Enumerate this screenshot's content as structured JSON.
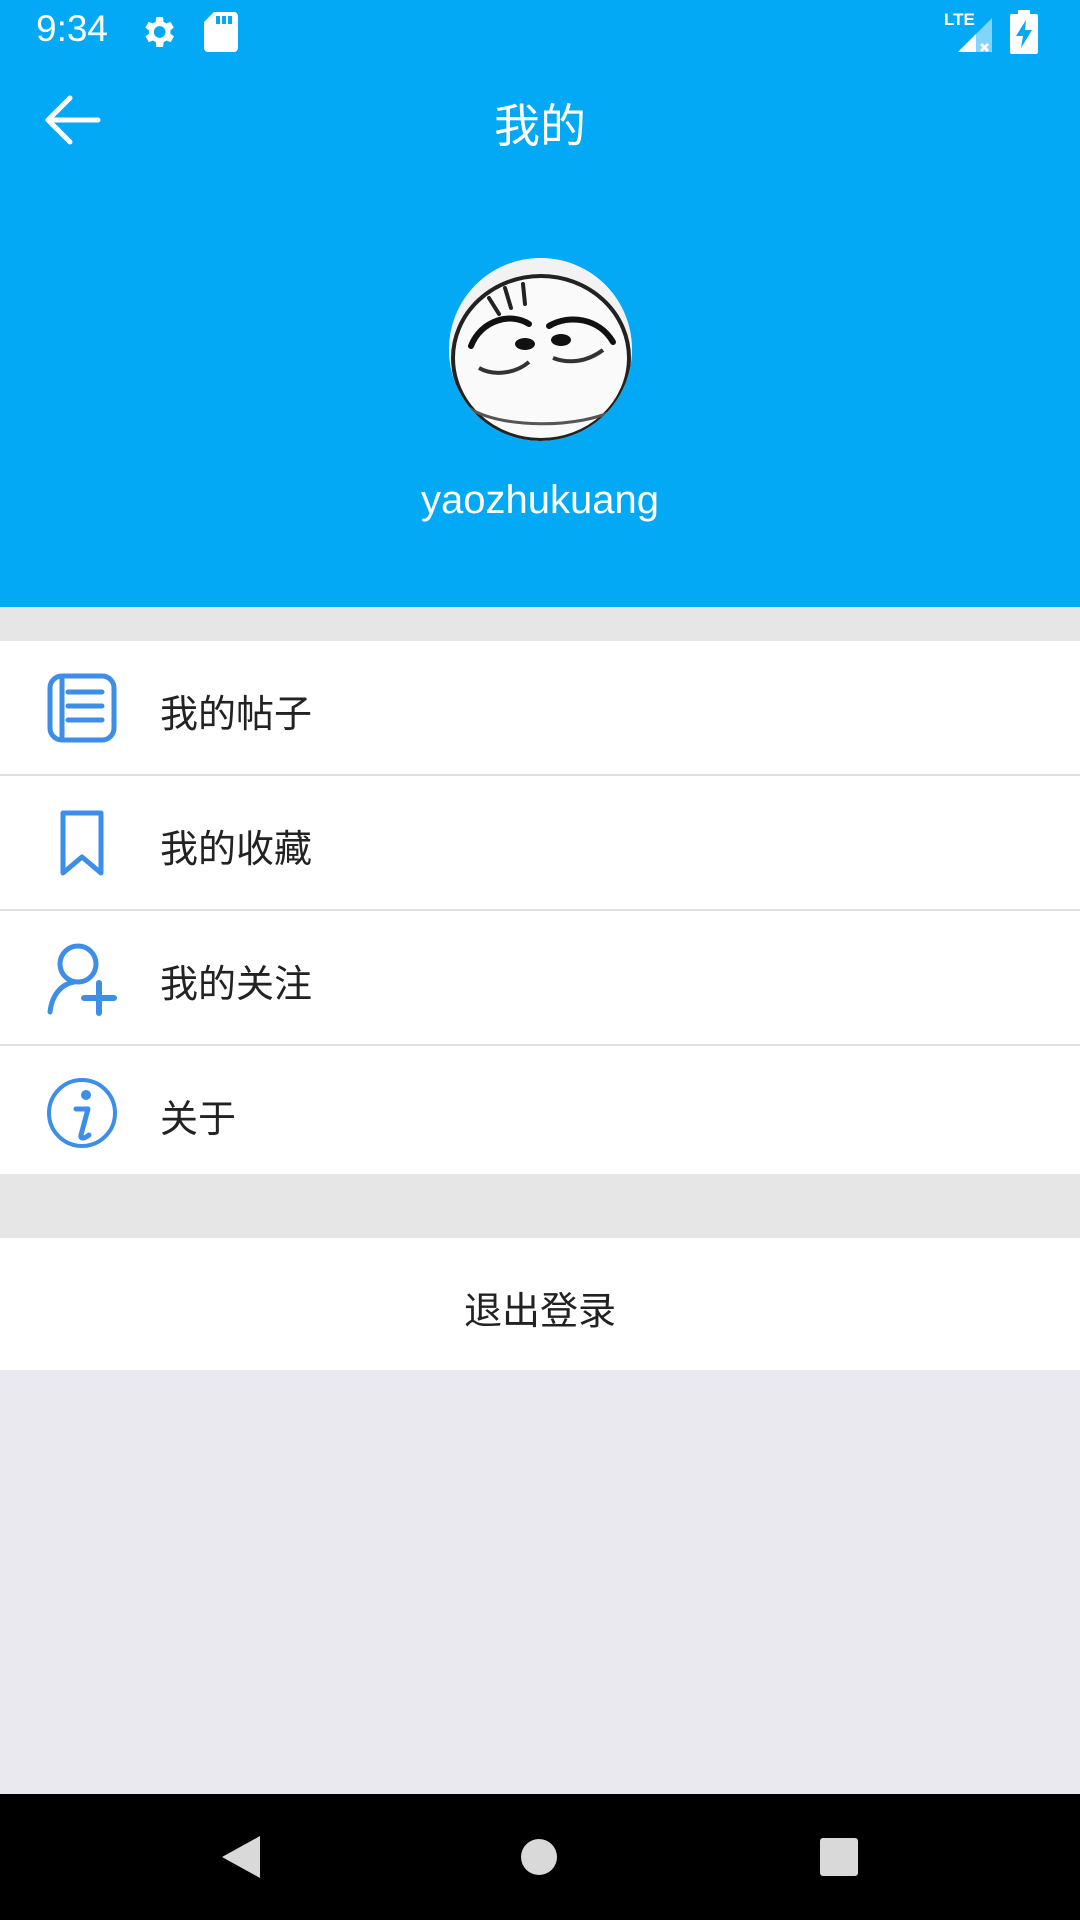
{
  "status_bar": {
    "time": "9:34",
    "network_label": "LTE",
    "icons": [
      "settings-gear-icon",
      "sd-card-icon",
      "lte-signal-icon",
      "battery-charging-icon"
    ]
  },
  "toolbar": {
    "back_icon": "arrow-left-icon",
    "title": "我的"
  },
  "profile": {
    "username": "yaozhukuang"
  },
  "menu": {
    "items": [
      {
        "label": "我的帖子",
        "icon": "posts-list-icon"
      },
      {
        "label": "我的收藏",
        "icon": "bookmark-icon"
      },
      {
        "label": "我的关注",
        "icon": "follow-user-plus-icon"
      },
      {
        "label": "关于",
        "icon": "info-icon"
      }
    ]
  },
  "logout": {
    "label": "退出登录"
  },
  "colors": {
    "header_bg": "#03a9f4",
    "icon_blue": "#3d8ee8",
    "page_bg": "#e9e9ef",
    "divider": "#e6e6e6"
  },
  "nav_bar": {
    "buttons": [
      "back-triangle-icon",
      "home-circle-icon",
      "recents-square-icon"
    ]
  }
}
